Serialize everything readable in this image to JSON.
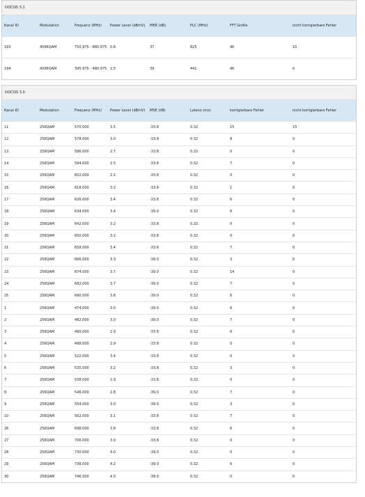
{
  "docsis31": {
    "title": "DOCSIS 3.1",
    "headers": [
      "Kanal ID",
      "Modulation",
      "Frequenz (MHz)",
      "Power Level (dBmV)",
      "MER (dB)",
      "PLC (MHz)",
      "FFT Größe",
      "nicht korrigierbare Fehler"
    ],
    "rows": [
      [
        "193",
        "4096QAM",
        "750.975 - 880.975",
        "0.8",
        "37",
        "825",
        "4K",
        "15"
      ],
      [
        "194",
        "4096QAM",
        "395.975 - 480.975",
        "2.5",
        "39",
        "441",
        "4K",
        "0"
      ]
    ]
  },
  "docsis30": {
    "title": "DOCSIS 3.0",
    "headers": [
      "Kanal ID",
      "Modulation",
      "Frequenz (MHz)",
      "Power Level (dBmV)",
      "MSE (dB)",
      "Latenz (ms)",
      "korrigierbare Fehler",
      "nicht korrigierbare Fehler"
    ],
    "rows": [
      [
        "11",
        "256QAM",
        "570.000",
        "3.5",
        "-33.8",
        "0.32",
        "15",
        "15"
      ],
      [
        "12",
        "256QAM",
        "578.000",
        "3.0",
        "-33.8",
        "0.32",
        "8",
        "0"
      ],
      [
        "13",
        "256QAM",
        "586.000",
        "2.7",
        "-33.8",
        "0.32",
        "0",
        "0"
      ],
      [
        "14",
        "256QAM",
        "594.000",
        "2.5",
        "-33.8",
        "0.32",
        "7",
        "0"
      ],
      [
        "15",
        "256QAM",
        "602.000",
        "2.2",
        "-33.8",
        "0.32",
        "0",
        "0"
      ],
      [
        "16",
        "256QAM",
        "618.000",
        "3.2",
        "-33.8",
        "0.32",
        "1",
        "0"
      ],
      [
        "17",
        "256QAM",
        "626.000",
        "3.4",
        "-33.8",
        "0.32",
        "6",
        "0"
      ],
      [
        "18",
        "256QAM",
        "634.000",
        "3.4",
        "-39.0",
        "0.32",
        "6",
        "0"
      ],
      [
        "19",
        "256QAM",
        "642.000",
        "3.2",
        "-33.8",
        "0.32",
        "0",
        "0"
      ],
      [
        "20",
        "256QAM",
        "650.000",
        "3.2",
        "-33.8",
        "0.32",
        "0",
        "0"
      ],
      [
        "21",
        "256QAM",
        "658.000",
        "3.4",
        "-33.8",
        "0.32",
        "7",
        "0"
      ],
      [
        "22",
        "256QAM",
        "666.000",
        "3.3",
        "-39.0",
        "0.32",
        "3",
        "0"
      ],
      [
        "23",
        "256QAM",
        "674.000",
        "3.7",
        "-39.0",
        "0.32",
        "14",
        "0"
      ],
      [
        "24",
        "256QAM",
        "682.000",
        "3.7",
        "-39.0",
        "0.32",
        "7",
        "0"
      ],
      [
        "25",
        "256QAM",
        "690.000",
        "3.8",
        "-39.0",
        "0.32",
        "6",
        "0"
      ],
      [
        "1",
        "256QAM",
        "474.000",
        "3.0",
        "-39.0",
        "0.32",
        "6",
        "0"
      ],
      [
        "2",
        "256QAM",
        "482.000",
        "3.0",
        "-39.0",
        "0.32",
        "7",
        "0"
      ],
      [
        "3",
        "256QAM",
        "490.000",
        "2.9",
        "-33.8",
        "0.32",
        "6",
        "0"
      ],
      [
        "4",
        "256QAM",
        "498.000",
        "2.9",
        "-33.8",
        "0.32",
        "0",
        "0"
      ],
      [
        "5",
        "256QAM",
        "522.000",
        "3.4",
        "-33.8",
        "0.32",
        "0",
        "0"
      ],
      [
        "6",
        "256QAM",
        "530.000",
        "3.2",
        "-33.8",
        "0.32",
        "3",
        "0"
      ],
      [
        "7",
        "256QAM",
        "538.000",
        "2.9",
        "-33.8",
        "0.32",
        "0",
        "0"
      ],
      [
        "8",
        "256QAM",
        "546.000",
        "2.8",
        "-39.0",
        "0.32",
        "7",
        "0"
      ],
      [
        "9",
        "256QAM",
        "554.000",
        "3.0",
        "-39.0",
        "0.32",
        "3",
        "0"
      ],
      [
        "10",
        "256QAM",
        "562.000",
        "3.1",
        "-33.8",
        "0.32",
        "7",
        "0"
      ],
      [
        "26",
        "256QAM",
        "698.000",
        "3.8",
        "-33.8",
        "0.32",
        "6",
        "0"
      ],
      [
        "27",
        "256QAM",
        "706.000",
        "3.9",
        "-33.8",
        "0.32",
        "0",
        "0"
      ],
      [
        "28",
        "256QAM",
        "730.000",
        "4.0",
        "-39.0",
        "0.32",
        "0",
        "0"
      ],
      [
        "29",
        "256QAM",
        "738.000",
        "4.2",
        "-39.0",
        "0.32",
        "6",
        "0"
      ],
      [
        "30",
        "256QAM",
        "746.000",
        "4.0",
        "-39.0",
        "0.32",
        "0",
        "0"
      ]
    ]
  }
}
